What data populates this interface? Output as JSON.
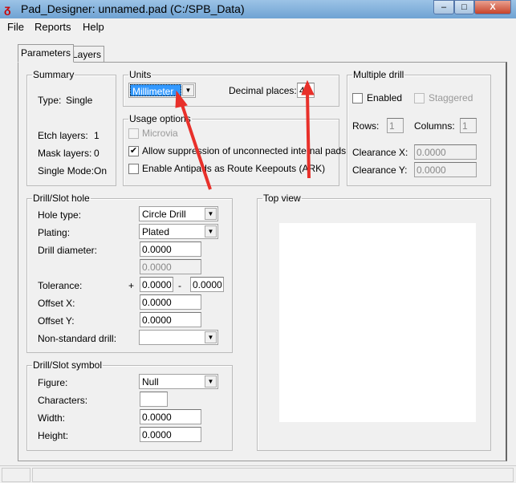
{
  "window": {
    "title": "Pad_Designer: unnamed.pad (C:/SPB_Data)",
    "minimize": "–",
    "maximize": "□",
    "close": "X"
  },
  "menu": [
    "File",
    "Reports",
    "Help"
  ],
  "tabs": [
    {
      "label": "Parameters",
      "active": true
    },
    {
      "label": "Layers",
      "active": false
    }
  ],
  "summary": {
    "title": "Summary",
    "type_label": "Type:",
    "type_value": "Single",
    "etch_label": "Etch layers:",
    "etch_value": "1",
    "mask_label": "Mask layers:",
    "mask_value": "0",
    "mode_label": "Single Mode:",
    "mode_value": "On"
  },
  "units": {
    "title": "Units",
    "selected": "Millimeter",
    "decimal_label": "Decimal places:",
    "decimal_value": "4"
  },
  "usage": {
    "title": "Usage options",
    "microvia": {
      "label": "Microvia",
      "checked": false,
      "disabled": true
    },
    "suppression": {
      "label": "Allow suppression of unconnected internal pads",
      "checked": true
    },
    "antipads": {
      "label": "Enable Antipads as Route Keepouts (ARK)",
      "checked": false
    }
  },
  "multiple_drill": {
    "title": "Multiple drill",
    "enabled_label": "Enabled",
    "staggered_label": "Staggered",
    "rows_label": "Rows:",
    "rows_value": "1",
    "columns_label": "Columns:",
    "columns_value": "1",
    "clearance_x_label": "Clearance X:",
    "clearance_x_value": "0.0000",
    "clearance_y_label": "Clearance Y:",
    "clearance_y_value": "0.0000"
  },
  "drill_hole": {
    "title": "Drill/Slot hole",
    "hole_type_label": "Hole type:",
    "hole_type_value": "Circle Drill",
    "plating_label": "Plating:",
    "plating_value": "Plated",
    "diameter_label": "Drill diameter:",
    "diameter_value": "0.0000",
    "diameter_value2": "0.0000",
    "tolerance_label": "Tolerance:",
    "plus": "+",
    "tol_plus": "0.0000",
    "minus": "-",
    "tol_minus": "0.0000",
    "offset_x_label": "Offset X:",
    "offset_x_value": "0.0000",
    "offset_y_label": "Offset Y:",
    "offset_y_value": "0.0000",
    "nonstd_label": "Non-standard drill:",
    "nonstd_value": ""
  },
  "drill_symbol": {
    "title": "Drill/Slot symbol",
    "figure_label": "Figure:",
    "figure_value": "Null",
    "characters_label": "Characters:",
    "characters_value": "",
    "width_label": "Width:",
    "width_value": "0.0000",
    "height_label": "Height:",
    "height_value": "0.0000"
  },
  "top_view": {
    "title": "Top view"
  },
  "annotation_color": "#e8302a"
}
